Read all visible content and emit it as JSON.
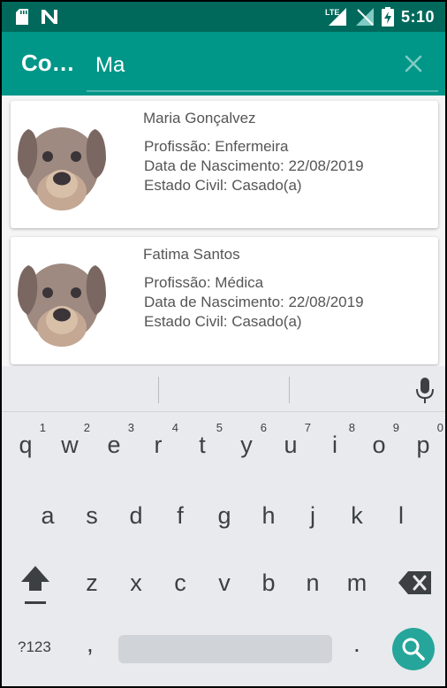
{
  "status_bar": {
    "time": "5:10",
    "network_label": "LTE",
    "icons": [
      "sd-card-icon",
      "n-notification-icon",
      "lte-signal-icon",
      "no-signal-icon",
      "battery-charging-icon"
    ]
  },
  "app_bar": {
    "title": "Co…",
    "search_query": "Ma",
    "close_icon": "close-icon"
  },
  "contacts": [
    {
      "name": "Maria Gonçalvez",
      "profession": "Profissão: Enfermeira",
      "birth": "Data de Nascimento: 22/08/2019",
      "marital": "Estado Civil: Casado(a)",
      "avatar_icon": "dog-avatar-icon"
    },
    {
      "name": "Fatima Santos",
      "profession": "Profissão: Médica",
      "birth": "Data de Nascimento: 22/08/2019",
      "marital": "Estado Civil: Casado(a)",
      "avatar_icon": "dog-avatar-icon"
    }
  ],
  "keyboard": {
    "row1": [
      {
        "k": "q",
        "n": "1"
      },
      {
        "k": "w",
        "n": "2"
      },
      {
        "k": "e",
        "n": "3"
      },
      {
        "k": "r",
        "n": "4"
      },
      {
        "k": "t",
        "n": "5"
      },
      {
        "k": "y",
        "n": "6"
      },
      {
        "k": "u",
        "n": "7"
      },
      {
        "k": "i",
        "n": "8"
      },
      {
        "k": "o",
        "n": "9"
      },
      {
        "k": "p",
        "n": "0"
      }
    ],
    "row2": [
      "a",
      "s",
      "d",
      "f",
      "g",
      "h",
      "j",
      "k",
      "l"
    ],
    "row3": [
      "z",
      "x",
      "c",
      "v",
      "b",
      "n",
      "m"
    ],
    "symbols_label": "?123",
    "comma": ",",
    "period": ".",
    "icons": [
      "mic-icon",
      "shift-icon",
      "backspace-icon",
      "search-icon"
    ]
  },
  "colors": {
    "status_bar": "#00695c",
    "app_bar": "#009688",
    "accent": "#26a69a",
    "keyboard_bg": "#e8eaed"
  }
}
